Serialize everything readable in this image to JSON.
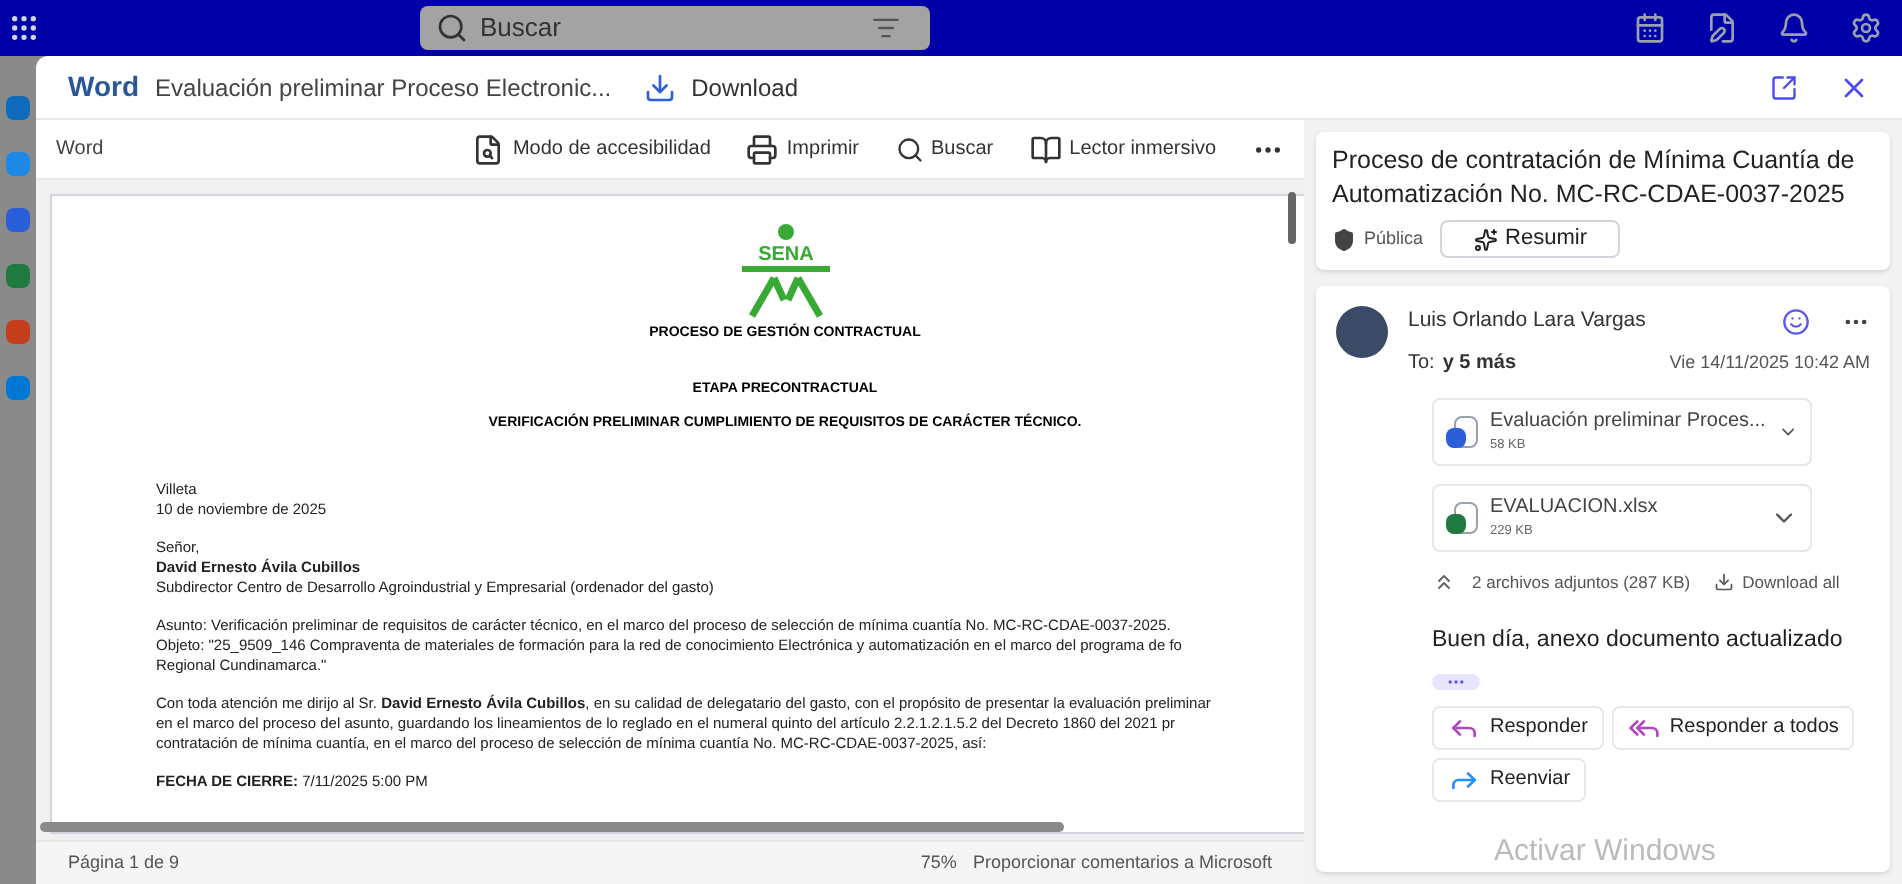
{
  "search": {
    "placeholder": "Buscar"
  },
  "viewer": {
    "app": "Word",
    "file_name": "Evaluación preliminar Proceso Electronic...",
    "download": "Download"
  },
  "toolbar": {
    "label": "Word",
    "actions": [
      {
        "label": "Modo de accesibilidad",
        "kind": "accessibility"
      },
      {
        "label": "Imprimir",
        "kind": "print"
      },
      {
        "label": "Buscar",
        "kind": "search"
      },
      {
        "label": "Lector inmersivo",
        "kind": "reader"
      }
    ]
  },
  "document": {
    "logo": "SENA",
    "headings": [
      "PROCESO DE GESTIÓN CONTRACTUAL",
      "ETAPA PRECONTRACTUAL",
      "VERIFICACIÓN PRELIMINAR CUMPLIMIENTO DE REQUISITOS DE CARÁCTER TÉCNICO."
    ],
    "blocks": [
      [
        {
          "text": "Villeta",
          "bold": false
        },
        {
          "text": "10 de noviembre de 2025",
          "bold": false
        }
      ],
      [
        {
          "text": "Señor,",
          "bold": false
        },
        {
          "text": "David Ernesto Ávila Cubillos",
          "bold": true
        },
        {
          "text": "Subdirector Centro de Desarrollo Agroindustrial y Empresarial (ordenador del gasto)",
          "bold": false
        }
      ],
      [
        {
          "text": "Asunto: Verificación preliminar de requisitos de carácter técnico, en el marco del proceso de selección de mínima cuantía No. MC-RC-CDAE-0037-2025.",
          "bold": false
        },
        {
          "text": "Objeto: \"25_9509_146 Compraventa de materiales de formación para la red de conocimiento Electrónica y automatización en el marco del programa de fo",
          "bold": false
        },
        {
          "text": "Regional Cundinamarca.\"",
          "bold": false
        }
      ],
      [
        {
          "text": "Con toda atención me dirijo al Sr. **David Ernesto Ávila Cubillos**, en su calidad de delegatario del gasto, con el propósito de presentar la evaluación preliminar",
          "bold": false
        },
        {
          "text": "en el marco del proceso del asunto, guardando los lineamientos de lo reglado en el numeral quinto del artículo 2.2.1.2.1.5.2 del Decreto 1860 del 2021 pr",
          "bold": false
        },
        {
          "text": "contratación de mínima cuantía, en el marco del proceso de selección de mínima cuantía No. MC-RC-CDAE-0037-2025, así:",
          "bold": false
        }
      ],
      [
        {
          "text": "**FECHA DE CIERRE:** 7/11/2025 5:00 PM",
          "bold": false
        }
      ]
    ]
  },
  "status_bar": {
    "page": "Página 1 de 9",
    "zoom": "75%",
    "feedback": "Proporcionar comentarios a Microsoft"
  },
  "email": {
    "subject": "Proceso de contratación de Mínima Cuantía de Automatización No. MC-RC-CDAE-0037-2025",
    "sensitivity": "Pública",
    "summarize": "Resumir",
    "sender": "Luis Orlando Lara Vargas",
    "to_label": "To:",
    "recipients": "y 5 más",
    "date": "Vie 14/11/2025 10:42 AM",
    "attachments": [
      {
        "name": "Evaluación preliminar Proces...",
        "size": "58 KB",
        "kind": "word"
      },
      {
        "name": "EVALUACION.xlsx",
        "size": "229 KB",
        "kind": "excel"
      }
    ],
    "attachments_summary": "2 archivos adjuntos (287 KB)",
    "download_all": "Download all",
    "body": "Buen día, anexo documento actualizado",
    "actions": [
      {
        "label": "Responder",
        "kind": "reply"
      },
      {
        "label": "Responder a todos",
        "kind": "reply_all"
      },
      {
        "label": "Reenviar",
        "kind": "forward"
      }
    ]
  },
  "os_notice": "Activar Windows"
}
